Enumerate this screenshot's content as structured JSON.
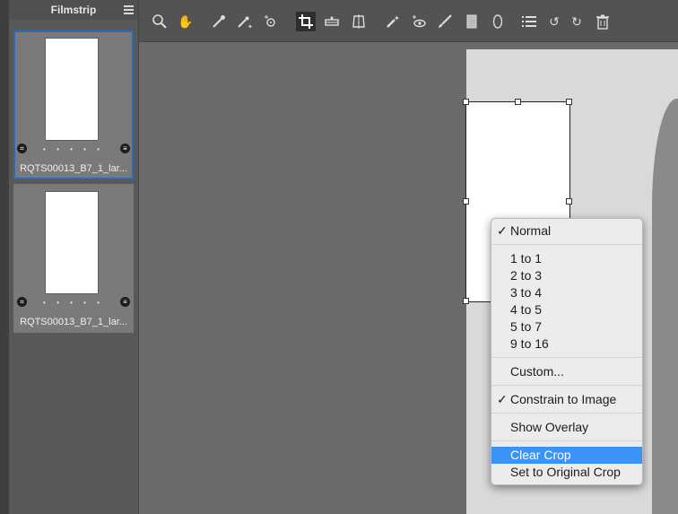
{
  "filmstrip": {
    "title": "Filmstrip",
    "items": [
      {
        "filename": "RQTS00013_B7_1_lar...",
        "dots": "• • • • •",
        "selected": true
      },
      {
        "filename": "RQTS00013_B7_1_lar...",
        "dots": "• • • • •",
        "selected": false
      }
    ]
  },
  "toolbar": {
    "tools": [
      "zoom-icon",
      "hand-icon",
      "eyedropper-icon",
      "auto-color-picker-icon",
      "target-adjust-icon",
      "crop-icon",
      "straighten-icon",
      "keystone-icon",
      "heal-icon",
      "red-eye-icon",
      "brush-icon",
      "gradient-mask-icon",
      "radial-mask-icon",
      "list-icon",
      "undo-icon",
      "redo-icon",
      "trash-icon"
    ],
    "active": "crop-icon"
  },
  "crop_menu": {
    "items": [
      {
        "label": "Normal",
        "checked": true
      },
      {
        "label": "1 to 1"
      },
      {
        "label": "2 to 3"
      },
      {
        "label": "3 to 4"
      },
      {
        "label": "4 to 5"
      },
      {
        "label": "5 to 7"
      },
      {
        "label": "9 to 16"
      },
      {
        "label": "Custom..."
      },
      {
        "label": "Constrain to Image",
        "checked": true
      },
      {
        "label": "Show Overlay"
      },
      {
        "label": "Clear Crop",
        "highlighted": true
      },
      {
        "label": "Set to Original Crop"
      }
    ],
    "checkmark": "✓"
  },
  "colors": {
    "selection": "#2b6cb3",
    "menu_highlight": "#3b93f7"
  }
}
